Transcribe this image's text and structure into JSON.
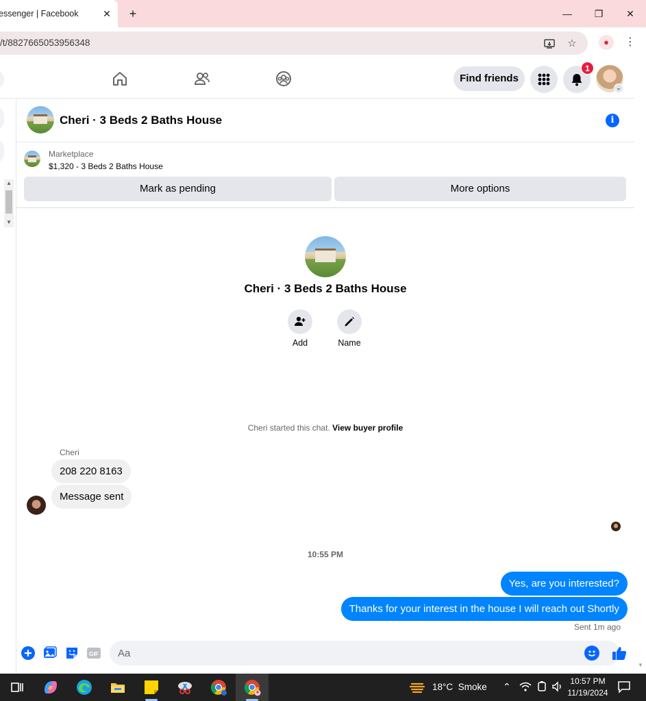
{
  "browser": {
    "tab_title": "essenger | Facebook",
    "tab_close": "✕",
    "new_tab": "+",
    "url": "/t/8827665053956348",
    "window_controls": [
      "—",
      "❐",
      "✕"
    ],
    "kebab": "⋮"
  },
  "header": {
    "find_friends": "Find friends",
    "notification_count": "1"
  },
  "chat": {
    "title": "Cheri · 3 Beds 2 Baths House",
    "marketplace_label": "Marketplace",
    "listing": "$1,320 - 3 Beds 2 Baths House",
    "mark_pending": "Mark as pending",
    "more_options": "More options",
    "center_name": "Cheri · 3 Beds 2 Baths House",
    "actions": [
      {
        "label": "Add",
        "icon": "add-person-icon"
      },
      {
        "label": "Name",
        "icon": "pencil-icon"
      }
    ],
    "started_text": "Cheri started this chat.",
    "view_buyer": "View buyer profile",
    "sender_name": "Cheri",
    "incoming": [
      "208 220 8163",
      "Message sent"
    ],
    "timestamp": "10:55 PM",
    "outgoing": [
      "Yes, are you interested?",
      "Thanks for your interest in the house I will reach out Shortly"
    ],
    "sent_status": "Sent 1m ago",
    "composer_placeholder": "Aa",
    "gif_label": "GIF"
  },
  "taskbar": {
    "temperature": "18°C",
    "weather": "Smoke",
    "time": "10:57 PM",
    "date": "11/19/2024"
  },
  "colors": {
    "fb_blue": "#0866ff",
    "messenger_blue": "#0084ff",
    "tab_bar": "#fadadd",
    "badge_red": "#e41e3f"
  }
}
